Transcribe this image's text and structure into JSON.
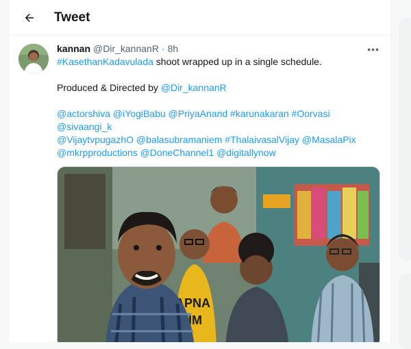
{
  "header": {
    "title": "Tweet"
  },
  "tweet": {
    "author_name": "kannan",
    "handle": "@Dir_kannanR",
    "separator": "·",
    "time": "8h",
    "more": "•••",
    "line1_hashtag": "#KasethanKadavulada",
    "line1_text": " shoot wrapped up in a single schedule.",
    "line2_text": "Produced & Directed by ",
    "line2_mention": "@Dir_kannanR",
    "line3": "@actorshiva @iYogiBabu @PriyaAnand #karunakaran #Oorvasi @sivaangi_k",
    "line4": "@VijaytvpugazhO @balasubramaniem #ThalaivasalVijay @MasalaPix",
    "line5": "@mkrpproductions @DoneChannel1 @digitallynow"
  },
  "media": {
    "shirt_text_1": "APNA",
    "shirt_text_2": "TIM"
  },
  "colors": {
    "link": "#1d9bf0",
    "text": "#0f1419",
    "secondary": "#536471",
    "border": "#eff3f4"
  },
  "icons": [
    "back-arrow-icon",
    "more-icon"
  ]
}
